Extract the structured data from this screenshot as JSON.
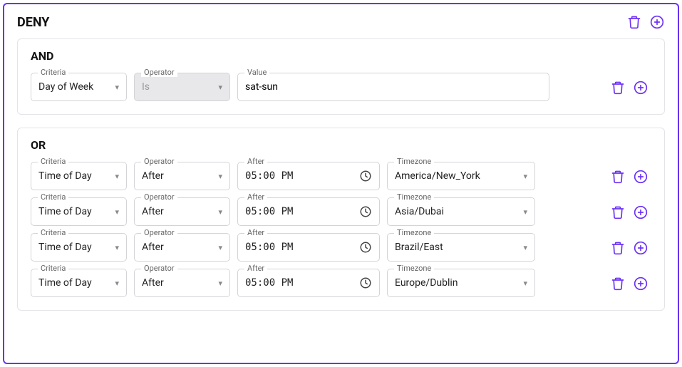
{
  "labels": {
    "criteria": "Criteria",
    "operator": "Operator",
    "value": "Value",
    "after": "After",
    "timezone": "Timezone"
  },
  "icons": {
    "trash": "trash-icon",
    "add": "add-icon",
    "chevron": "▾",
    "clock": "clock-icon"
  },
  "deny": {
    "title": "DENY",
    "groups": [
      {
        "title": "AND",
        "rows": [
          {
            "criteria": "Day of Week",
            "operator": "Is",
            "operator_disabled": true,
            "value": "sat-sun"
          }
        ]
      },
      {
        "title": "OR",
        "rows": [
          {
            "criteria": "Time of Day",
            "operator": "After",
            "after": "05:00 PM",
            "timezone": "America/New_York"
          },
          {
            "criteria": "Time of Day",
            "operator": "After",
            "after": "05:00 PM",
            "timezone": "Asia/Dubai"
          },
          {
            "criteria": "Time of Day",
            "operator": "After",
            "after": "05:00 PM",
            "timezone": "Brazil/East"
          },
          {
            "criteria": "Time of Day",
            "operator": "After",
            "after": "05:00 PM",
            "timezone": "Europe/Dublin"
          }
        ]
      }
    ]
  }
}
